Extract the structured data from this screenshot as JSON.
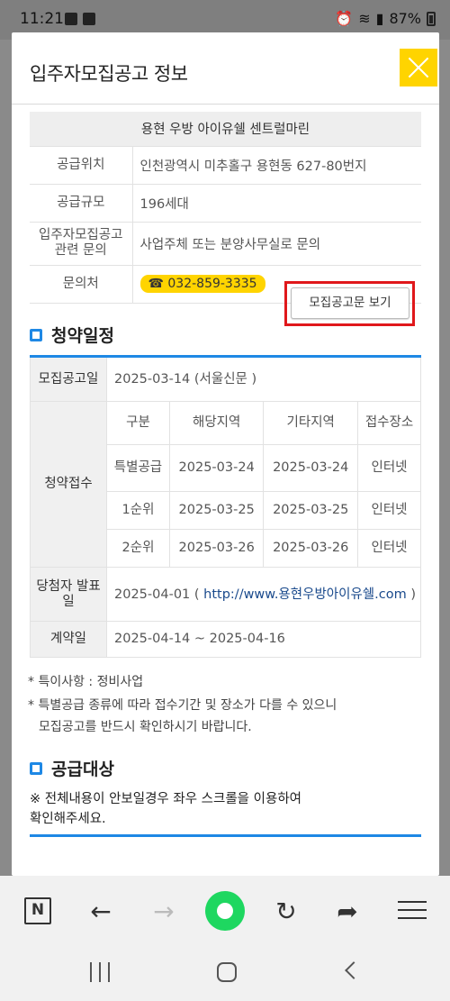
{
  "status": {
    "time": "11:21",
    "battery": "87%"
  },
  "modal": {
    "title": "입주자모집공고 정보",
    "info": {
      "name": "용현 우방 아이유쉘 센트럴마린",
      "rows": [
        {
          "label": "공급위치",
          "value": "인천광역시 미추홀구 용현동 627-80번지"
        },
        {
          "label": "공급규모",
          "value": "196세대"
        },
        {
          "label": "입주자모집공고 관련 문의",
          "value": "사업주체 또는 분양사무실로 문의"
        },
        {
          "label": "문의처",
          "value": "☎ 032-859-3335"
        }
      ]
    },
    "notice_button": "모집공고문 보기",
    "schedule": {
      "title": "청약일정",
      "announce_label": "모집공고일",
      "announce_value": "2025-03-14 (서울신문 )",
      "apply_label": "청약접수",
      "headers": [
        "구분",
        "해당지역",
        "기타지역",
        "접수장소"
      ],
      "rows": [
        [
          "특별공급",
          "2025-03-24",
          "2025-03-24",
          "인터넷"
        ],
        [
          "1순위",
          "2025-03-25",
          "2025-03-25",
          "인터넷"
        ],
        [
          "2순위",
          "2025-03-26",
          "2025-03-26",
          "인터넷"
        ]
      ],
      "winner_label": "당첨자 발표일",
      "winner_date": "2025-04-01 ( ",
      "winner_link": "http://www.용현우방아이유쉘.com",
      "winner_close": " )",
      "contract_label": "계약일",
      "contract_value": "2025-04-14 ~ 2025-04-16"
    },
    "notes": [
      "* 특이사항 : 정비사업",
      "* 특별공급 종류에 따라 접수기간 및 장소가 다를 수 있으니",
      "모집공고를 반드시 확인하시기 바랍니다."
    ],
    "supply": {
      "title": "공급대상",
      "line1": "※ 전체내용이 안보일경우 좌우 스크롤을 이용하여",
      "line2": "확인해주세요."
    }
  },
  "browser": {
    "n_label": "N"
  }
}
